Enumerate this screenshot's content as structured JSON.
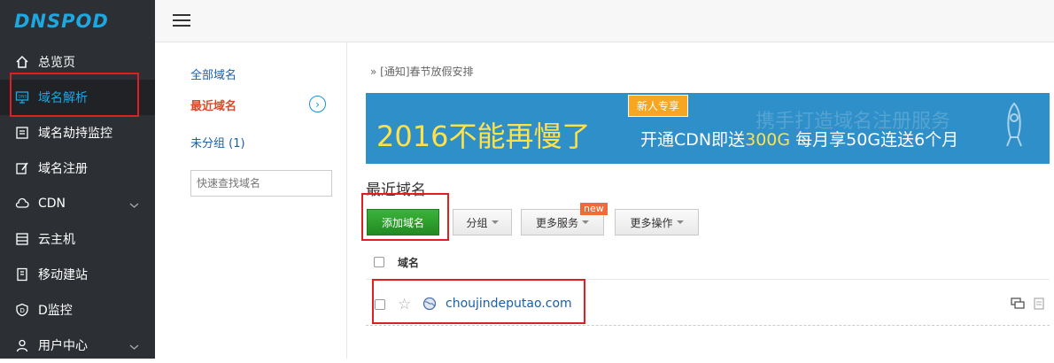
{
  "brand": {
    "logo_text": "DNSPOD",
    "accent": "#1ea7e0"
  },
  "sidebar": {
    "items": [
      {
        "label": "总览页",
        "icon": "home-icon"
      },
      {
        "label": "域名解析",
        "icon": "dns-icon",
        "active": true
      },
      {
        "label": "域名劫持监控",
        "icon": "monitor-list-icon"
      },
      {
        "label": "域名注册",
        "icon": "edit-doc-icon"
      },
      {
        "label": "CDN",
        "icon": "cloud-icon",
        "expandable": true
      },
      {
        "label": "云主机",
        "icon": "server-icon"
      },
      {
        "label": "移动建站",
        "icon": "mobile-site-icon"
      },
      {
        "label": "D监控",
        "icon": "shield-d-icon"
      },
      {
        "label": "用户中心",
        "icon": "user-icon",
        "expandable": true
      }
    ]
  },
  "subnav": {
    "all_domains": "全部域名",
    "recent_domains": "最近域名",
    "ungrouped": "未分组 (1)",
    "search_placeholder": "快速查找域名"
  },
  "notice": {
    "prefix": "»",
    "text": "[通知]春节放假安排"
  },
  "banner": {
    "tag": "新人专享",
    "headline": "2016不能再慢了",
    "offer_prefix": "开通CDN即送",
    "offer_amount": "300G",
    "offer_suffix": " 每月享50G连送6个月",
    "ghost_text": "携手打造域名注册服务"
  },
  "main": {
    "title": "最近域名",
    "buttons": {
      "add_domain": "添加域名",
      "group": "分组",
      "more_services": "更多服务",
      "more_actions": "更多操作",
      "new_badge": "new"
    },
    "table": {
      "column_domain": "域名",
      "rows": [
        {
          "domain": "choujindeputao.com"
        }
      ]
    }
  }
}
